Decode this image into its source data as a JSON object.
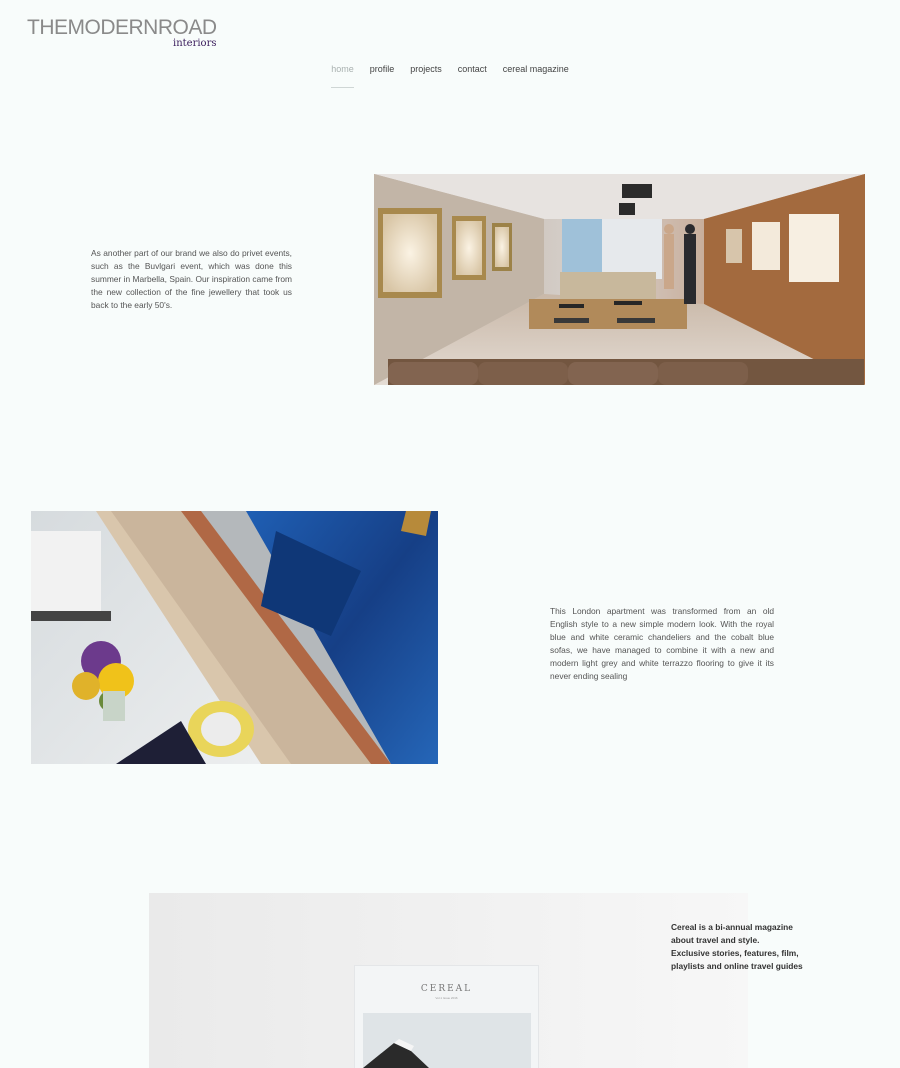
{
  "brand": {
    "name": "THEMODERNROAD",
    "sub": "interiors"
  },
  "nav": {
    "items": [
      {
        "label": "home",
        "active": true
      },
      {
        "label": "profile",
        "active": false
      },
      {
        "label": "projects",
        "active": false
      },
      {
        "label": "contact",
        "active": false
      },
      {
        "label": "cereal magazine",
        "active": false
      }
    ]
  },
  "section1": {
    "text": "As another part of our brand we also do privet events, such as the Buvlgari event, which was done this summer in Marbella, Spain. Our inspiration came from the new collection of the fine jewellery that took us back to the early 50's."
  },
  "section2": {
    "text": "This London apartment was transformed from an old English style to a new simple modern look. With the royal blue and white ceramic chandeliers and the cobalt blue sofas, we have managed to combine it with a new and modern light grey and white terrazzo flooring to give it its never ending sealing"
  },
  "section3": {
    "lines": [
      "Cereal is a bi-annual magazine",
      "about travel and style.",
      "Exclusive stories, features, film,",
      "playlists and online travel guides"
    ],
    "magazine_title": "CEREAL",
    "magazine_sub": "Vol.1 Issue 2016"
  },
  "colors": {
    "background": "#f8fcfb",
    "nav_active": "#a9b1b0",
    "logo_sub": "#3a1c5c",
    "sofa_blue": "#1a4c9c"
  }
}
